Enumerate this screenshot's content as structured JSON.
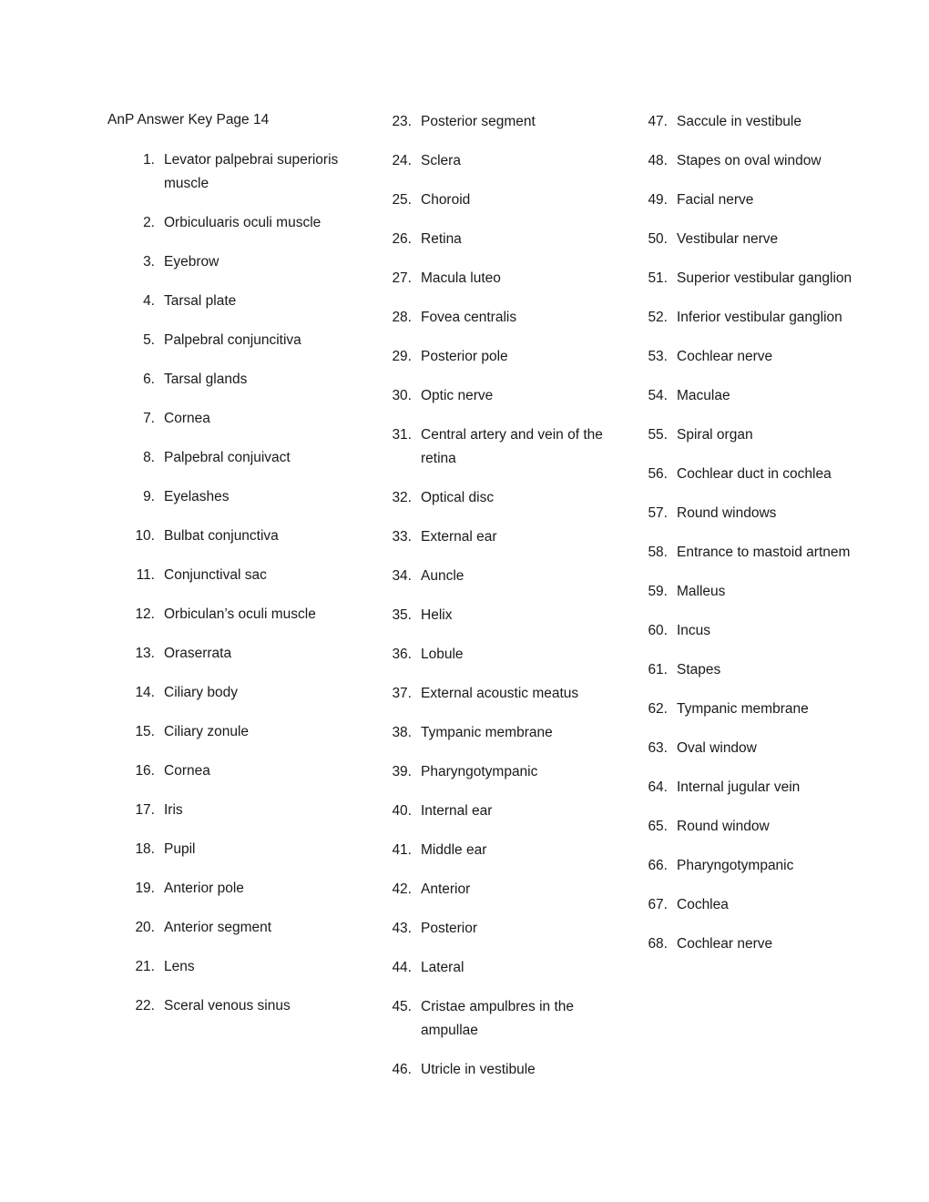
{
  "document": {
    "title": "AnP Answer Key Page 14",
    "page_number": "14"
  },
  "columns": [
    {
      "name": "column-one",
      "items": [
        {
          "number": "1.",
          "text": "Levator palpebrai superioris muscle"
        },
        {
          "number": "2.",
          "text": "Orbiculuaris oculi muscle"
        },
        {
          "number": "3.",
          "text": "Eyebrow"
        },
        {
          "number": "4.",
          "text": "Tarsal plate"
        },
        {
          "number": "5.",
          "text": "Palpebral conjuncitiva"
        },
        {
          "number": "6.",
          "text": "Tarsal glands"
        },
        {
          "number": "7.",
          "text": "Cornea"
        },
        {
          "number": "8.",
          "text": "Palpebral conjuivact"
        },
        {
          "number": "9.",
          "text": "Eyelashes"
        },
        {
          "number": "10.",
          "text": "Bulbat conjunctiva"
        },
        {
          "number": "11.",
          "text": "Conjunctival sac"
        },
        {
          "number": "12.",
          "text": "Orbiculan’s oculi muscle"
        },
        {
          "number": "13.",
          "text": "Oraserrata"
        },
        {
          "number": "14.",
          "text": "Ciliary body"
        },
        {
          "number": "15.",
          "text": "Ciliary zonule"
        },
        {
          "number": "16.",
          "text": "Cornea"
        },
        {
          "number": "17.",
          "text": "Iris"
        },
        {
          "number": "18.",
          "text": "Pupil"
        },
        {
          "number": "19.",
          "text": "Anterior pole"
        },
        {
          "number": "20.",
          "text": "Anterior segment"
        },
        {
          "number": "21.",
          "text": "Lens"
        },
        {
          "number": "22.",
          "text": "Sceral venous sinus"
        }
      ]
    },
    {
      "name": "column-two",
      "items": [
        {
          "number": "23.",
          "text": "Posterior segment"
        },
        {
          "number": "24.",
          "text": "Sclera"
        },
        {
          "number": "25.",
          "text": "Choroid"
        },
        {
          "number": "26.",
          "text": "Retina"
        },
        {
          "number": "27.",
          "text": "Macula luteo"
        },
        {
          "number": "28.",
          "text": "Fovea centralis"
        },
        {
          "number": "29.",
          "text": "Posterior pole"
        },
        {
          "number": "30.",
          "text": "Optic nerve"
        },
        {
          "number": "31.",
          "text": "Central artery and vein of the retina"
        },
        {
          "number": "32.",
          "text": "Optical disc"
        },
        {
          "number": "33.",
          "text": "External ear"
        },
        {
          "number": "34.",
          "text": "Auncle"
        },
        {
          "number": "35.",
          "text": "Helix"
        },
        {
          "number": "36.",
          "text": "Lobule"
        },
        {
          "number": "37.",
          "text": "External acoustic meatus"
        },
        {
          "number": "38.",
          "text": "Tympanic membrane"
        },
        {
          "number": "39.",
          "text": "Pharyngotympanic"
        },
        {
          "number": "40.",
          "text": "Internal ear"
        },
        {
          "number": "41.",
          "text": "Middle ear"
        },
        {
          "number": "42.",
          "text": "Anterior"
        },
        {
          "number": "43.",
          "text": "Posterior"
        },
        {
          "number": "44.",
          "text": "Lateral"
        },
        {
          "number": "45.",
          "text": "Cristae ampulbres in the ampullae"
        },
        {
          "number": "46.",
          "text": "Utricle in vestibule"
        }
      ]
    },
    {
      "name": "column-three",
      "items": [
        {
          "number": "47.",
          "text": "Saccule in vestibule"
        },
        {
          "number": "48.",
          "text": "Stapes on oval window"
        },
        {
          "number": "49.",
          "text": "Facial nerve"
        },
        {
          "number": "50.",
          "text": "Vestibular nerve"
        },
        {
          "number": "51.",
          "text": "Superior vestibular ganglion"
        },
        {
          "number": "52.",
          "text": "Inferior vestibular ganglion"
        },
        {
          "number": "53.",
          "text": "Cochlear nerve"
        },
        {
          "number": "54.",
          "text": "Maculae"
        },
        {
          "number": "55.",
          "text": "Spiral organ"
        },
        {
          "number": "56.",
          "text": "Cochlear duct in cochlea"
        },
        {
          "number": "57.",
          "text": "Round windows"
        },
        {
          "number": "58.",
          "text": "Entrance to mastoid artnem"
        },
        {
          "number": "59.",
          "text": "Malleus"
        },
        {
          "number": "60.",
          "text": "Incus"
        },
        {
          "number": "61.",
          "text": "Stapes"
        },
        {
          "number": "62.",
          "text": "Tympanic membrane"
        },
        {
          "number": "63.",
          "text": "Oval window"
        },
        {
          "number": "64.",
          "text": "Internal jugular vein"
        },
        {
          "number": "65.",
          "text": "Round window"
        },
        {
          "number": "66.",
          "text": "Pharyngotympanic"
        },
        {
          "number": "67.",
          "text": "Cochlea"
        },
        {
          "number": "68.",
          "text": "Cochlear nerve"
        }
      ]
    }
  ],
  "theme": {
    "text_color": "#1a1a1a",
    "background_color": "#ffffff"
  }
}
